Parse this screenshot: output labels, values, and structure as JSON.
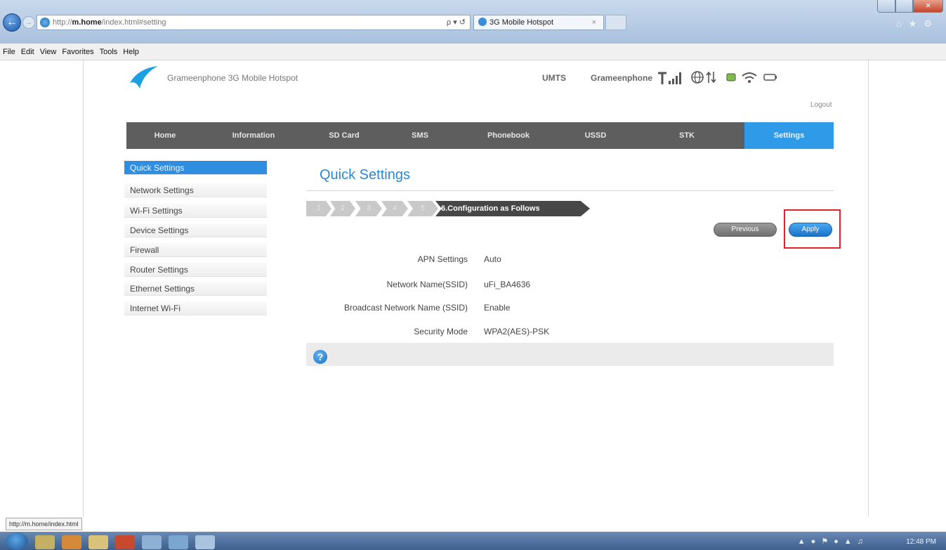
{
  "browser": {
    "url_prefix": "http://",
    "url_host": "m.home",
    "url_path": "/index.html#setting",
    "address_tools": "ρ ▾ ↺",
    "tab_title": "3G Mobile Hotspot",
    "tab_close": "×",
    "menu": [
      "File",
      "Edit",
      "View",
      "Favorites",
      "Tools",
      "Help"
    ],
    "status_url": "http://m.home/index.html"
  },
  "header": {
    "brand": "Grameenphone 3G Mobile Hotspot",
    "network_type": "UMTS",
    "operator": "Grameenphone",
    "logout": "Logout"
  },
  "nav": {
    "items": [
      {
        "label": "Home"
      },
      {
        "label": "Information"
      },
      {
        "label": "SD Card"
      },
      {
        "label": "SMS"
      },
      {
        "label": "Phonebook"
      },
      {
        "label": "USSD"
      },
      {
        "label": "STK"
      },
      {
        "label": "Settings"
      }
    ],
    "active": "Settings"
  },
  "sidemenu": {
    "items": [
      {
        "label": "Quick Settings"
      },
      {
        "label": "Network Settings"
      },
      {
        "label": "Wi-Fi Settings"
      },
      {
        "label": "Device Settings"
      },
      {
        "label": "Firewall"
      },
      {
        "label": "Router Settings"
      },
      {
        "label": "Ethernet Settings"
      },
      {
        "label": "Internet Wi-Fi"
      }
    ]
  },
  "content": {
    "title": "Quick Settings",
    "steps": [
      "1",
      "2",
      "3",
      "4",
      "5"
    ],
    "current_step": "6.Configuration as Follows",
    "previous_label": "Previous",
    "apply_label": "Apply",
    "rows": [
      {
        "label": "APN Settings",
        "value": "Auto"
      },
      {
        "label": "Network Name(SSID)",
        "value": "uFi_BA4636"
      },
      {
        "label": "Broadcast Network Name (SSID)",
        "value": "Enable"
      },
      {
        "label": "Security Mode",
        "value": "WPA2(AES)-PSK"
      }
    ],
    "help_glyph": "?"
  },
  "taskbar": {
    "clock": "12:48 PM"
  },
  "colors": {
    "accent": "#2f9be8",
    "nav_bg": "#5e5e5e",
    "highlight": "#e32228"
  }
}
